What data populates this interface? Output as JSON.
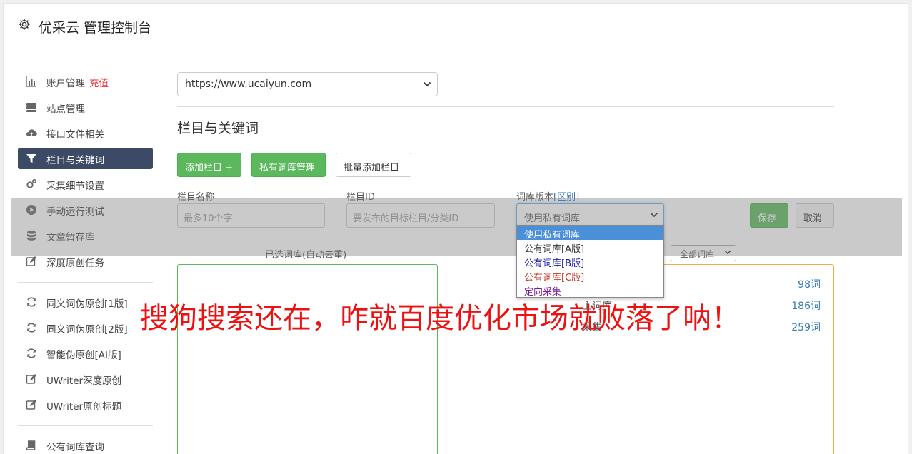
{
  "header": {
    "title": "优采云 管理控制台"
  },
  "sidebar": {
    "items": [
      {
        "label": "账户管理",
        "extra": "充值",
        "icon": "bar-chart-icon"
      },
      {
        "label": "站点管理",
        "icon": "server-icon"
      },
      {
        "label": "接口文件相关",
        "icon": "cloud-upload-icon"
      },
      {
        "label": "栏目与关键词",
        "icon": "filter-icon",
        "active": true
      },
      {
        "label": "采集细节设置",
        "icon": "cogs-icon"
      },
      {
        "label": "手动运行测试",
        "icon": "play-circle-icon"
      },
      {
        "label": "文章暂存库",
        "icon": "database-icon"
      },
      {
        "label": "深度原创任务",
        "icon": "edit-icon"
      }
    ],
    "tools": [
      {
        "label": "同义词伪原创[1版]",
        "icon": "refresh-icon"
      },
      {
        "label": "同义词伪原创[2版]",
        "icon": "refresh-icon"
      },
      {
        "label": "智能伪原创[AI版]",
        "icon": "refresh-icon"
      },
      {
        "label": "UWriter深度原创",
        "icon": "edit-icon"
      },
      {
        "label": "UWriter原创标题",
        "icon": "edit-icon"
      }
    ],
    "extra": [
      {
        "label": "公有词库查询",
        "icon": "book-icon"
      }
    ]
  },
  "main": {
    "site_select": "https://www.ucaiyun.com",
    "section_title": "栏目与关键词",
    "buttons": {
      "add_column": "添加栏目 +",
      "private_lib": "私有词库管理",
      "batch_add": "批量添加栏目"
    },
    "form": {
      "name_label": "栏目名称",
      "name_placeholder": "最多10个字",
      "id_label": "栏目ID",
      "id_placeholder": "要发布的目标栏目/分类ID",
      "version_label": "词库版本",
      "version_link": "[区别]",
      "version_value": "使用私有词库",
      "save": "保存",
      "cancel": "取消"
    },
    "version_options": [
      {
        "label": "使用私有词库",
        "color": "#ffffff",
        "selected": true
      },
      {
        "label": "公有词库[A版]",
        "color": "#333333"
      },
      {
        "label": "公有词库[B版]",
        "color": "#1a1aa6"
      },
      {
        "label": "公有词库[C版]",
        "color": "#c0392b"
      },
      {
        "label": "定向采集",
        "color": "#7a1fa2"
      }
    ],
    "selected_libs_label": "已选词库(自动去重)",
    "all_libs_select": "全部词库",
    "libs": [
      {
        "name": "",
        "count": "98词"
      },
      {
        "name": "主词库",
        "count": "186词"
      },
      {
        "name": "采集",
        "count": "259词"
      }
    ]
  },
  "overlay_caption": "搜狗搜索还在，咋就百度优化市场就败落了呐！",
  "colors": {
    "accent_green": "#5cb85c",
    "active_nav": "#3c4a65",
    "warn_orange": "#f0ad4e",
    "caption_red": "#ee1111"
  }
}
